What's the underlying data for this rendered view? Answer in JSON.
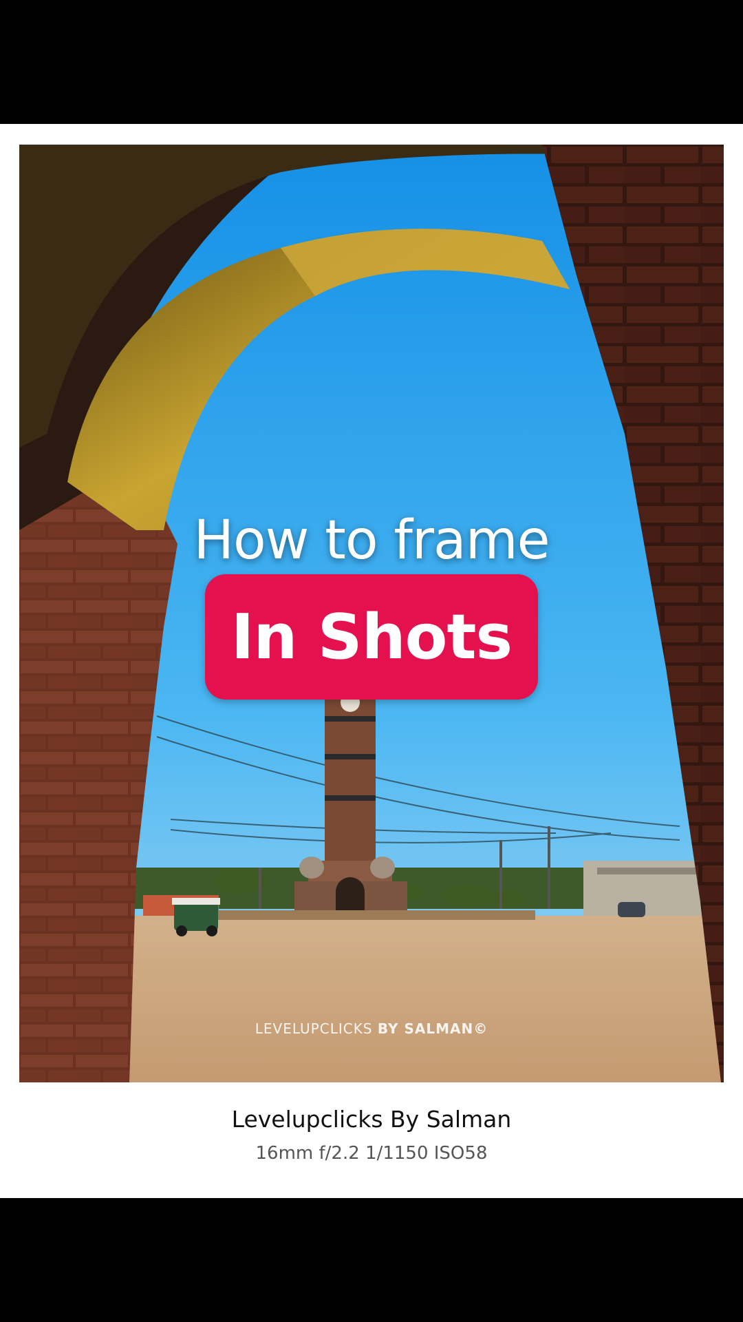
{
  "overlay": {
    "headline": "How to frame",
    "highlight": "In Shots"
  },
  "photo": {
    "watermark_left": "LEVELUPCLICKS",
    "watermark_right": "BY SALMAN©"
  },
  "caption": {
    "author": "Levelupclicks By Salman",
    "camera_info": "16mm f/2.2 1/1150 ISO58"
  },
  "colors": {
    "highlight_bg": "#e5104e",
    "sky": "#2aa6ee",
    "brick": "#7a3b26"
  }
}
